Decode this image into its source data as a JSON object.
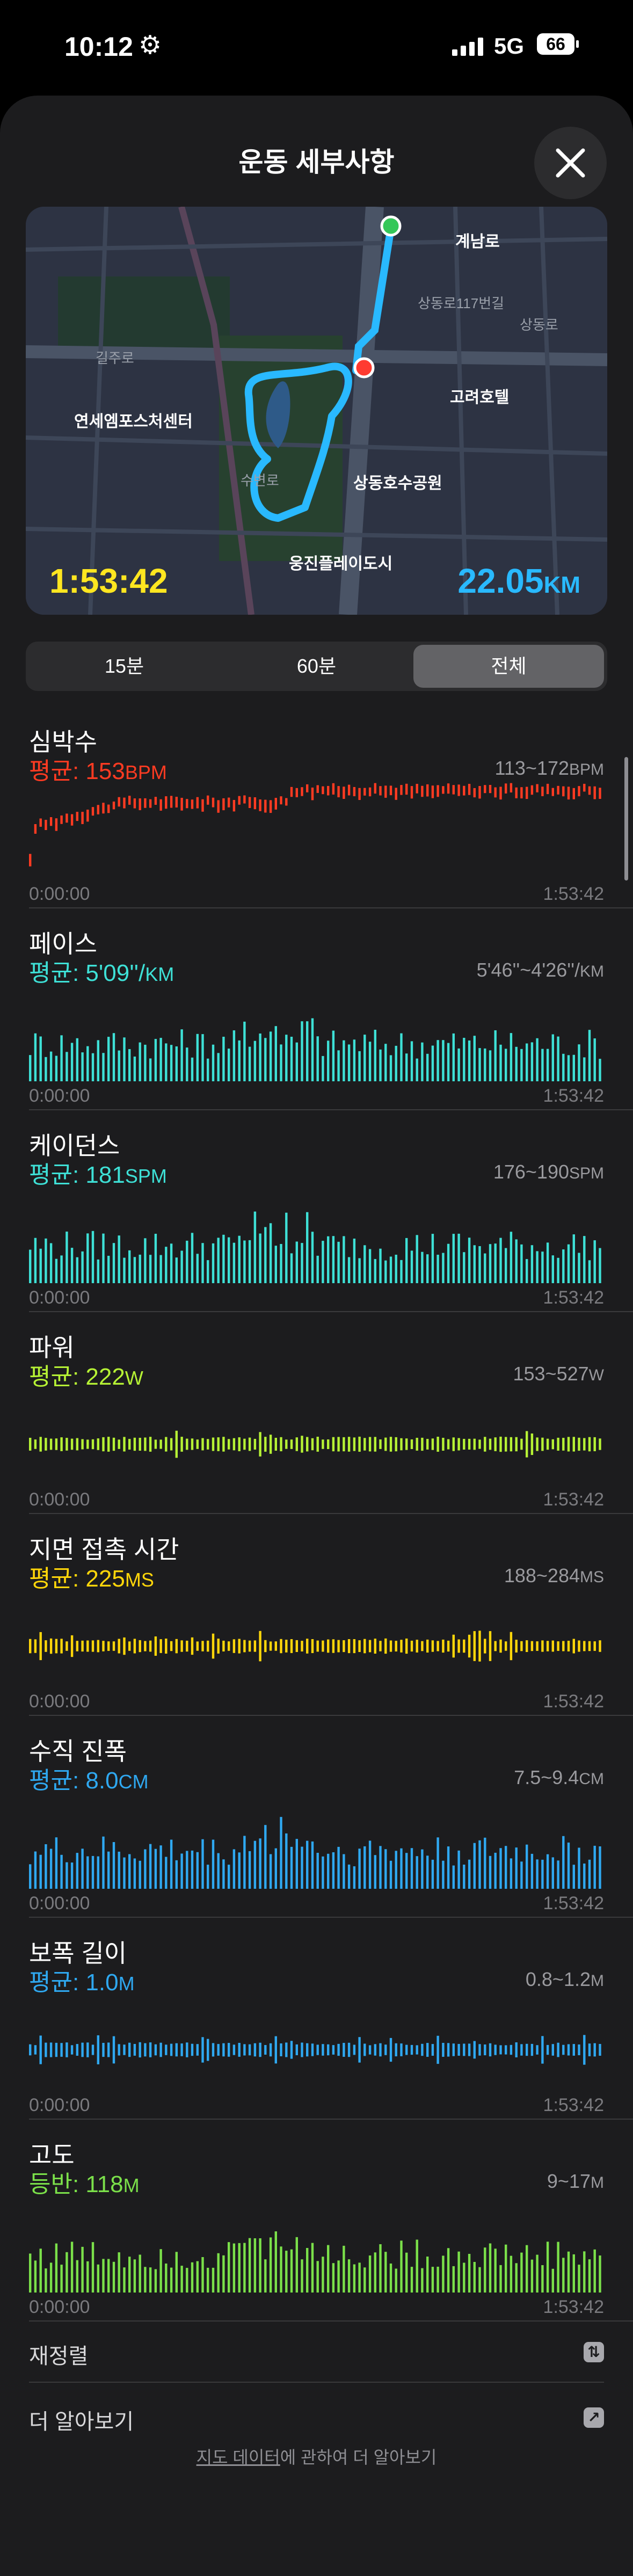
{
  "status": {
    "time": "10:12",
    "network": "5G",
    "battery": "66"
  },
  "header": {
    "title": "운동 세부사항"
  },
  "map": {
    "duration": "1:53:42",
    "distance_value": "22.05",
    "distance_unit": "KM",
    "labels": [
      "계남로",
      "상동로117번길",
      "고려호텔",
      "길주로",
      "연세엠포스처센터",
      "상동호수공원",
      "웅진플레이도시",
      "수변로",
      "상동로"
    ]
  },
  "segments": {
    "options": [
      "15분",
      "60분",
      "전체"
    ],
    "selected": "전체"
  },
  "metrics": [
    {
      "name": "심박수",
      "avg_label": "평균: ",
      "avg_value": "153",
      "avg_unit": "BPM",
      "range": "113~172",
      "range_unit": "BPM",
      "color": "#ff3b22",
      "style": "line",
      "start": "0:00:00",
      "end": "1:53:42"
    },
    {
      "name": "페이스",
      "avg_label": "평균: ",
      "avg_value": "5'09''/",
      "avg_unit": "KM",
      "range": "5'46''~4'26''/",
      "range_unit": "KM",
      "color": "#3ee0d6",
      "style": "bars",
      "start": "0:00:00",
      "end": "1:53:42"
    },
    {
      "name": "케이던스",
      "avg_label": "평균: ",
      "avg_value": "181",
      "avg_unit": "SPM",
      "range": "176~190",
      "range_unit": "SPM",
      "color": "#3ee0d6",
      "style": "bars",
      "start": "0:00:00",
      "end": "1:53:42"
    },
    {
      "name": "파워",
      "avg_label": "평균: ",
      "avg_value": "222",
      "avg_unit": "W",
      "range": "153~527",
      "range_unit": "W",
      "color": "#b6f235",
      "style": "spikes",
      "start": "0:00:00",
      "end": "1:53:42"
    },
    {
      "name": "지면 접촉 시간",
      "avg_label": "평균: ",
      "avg_value": "225",
      "avg_unit": "MS",
      "range": "188~284",
      "range_unit": "MS",
      "color": "#ffd60a",
      "style": "spikes",
      "start": "0:00:00",
      "end": "1:53:42"
    },
    {
      "name": "수직 진폭",
      "avg_label": "평균: ",
      "avg_value": "8.0",
      "avg_unit": "CM",
      "range": "7.5~9.4",
      "range_unit": "CM",
      "color": "#2fa8f0",
      "style": "bars",
      "start": "0:00:00",
      "end": "1:53:42"
    },
    {
      "name": "보폭 길이",
      "avg_label": "평균: ",
      "avg_value": "1.0",
      "avg_unit": "M",
      "range": "0.8~1.2",
      "range_unit": "M",
      "color": "#2fa8f0",
      "style": "spikes",
      "start": "0:00:00",
      "end": "1:53:42"
    },
    {
      "name": "고도",
      "avg_label": "등반: ",
      "avg_value": "118",
      "avg_unit": "M",
      "range": "9~17",
      "range_unit": "M",
      "color": "#7be04a",
      "style": "bars",
      "start": "0:00:00",
      "end": "1:53:42"
    }
  ],
  "rows": {
    "reorder": "재정렬",
    "learn_more": "더 알아보기"
  },
  "footer": {
    "link": "지도 데이터",
    "text": "에 관하여 더 알아보기"
  },
  "icons": {
    "settings": "gear-icon",
    "close": "close-icon",
    "reorder": "swap-icon",
    "external": "arrow-out-icon"
  }
}
